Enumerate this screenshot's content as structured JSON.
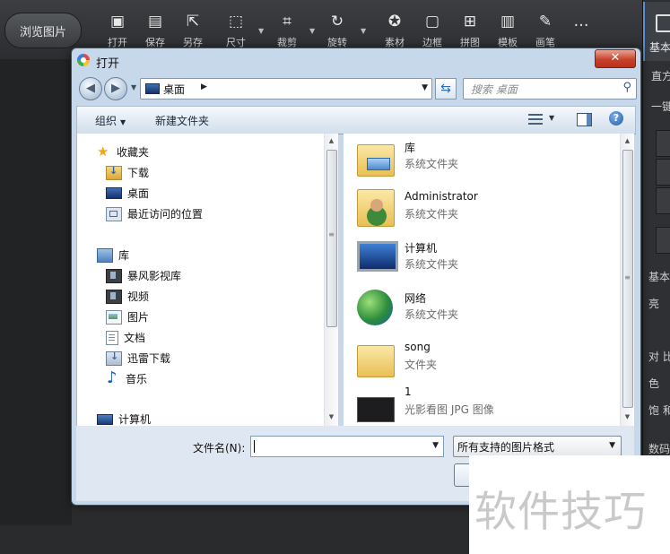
{
  "app": {
    "browse_button": "浏览图片",
    "tools": [
      {
        "label": "打开",
        "icon": "open-icon"
      },
      {
        "label": "保存",
        "icon": "save-icon"
      },
      {
        "label": "另存",
        "icon": "save-as-icon"
      },
      {
        "label": "尺寸",
        "icon": "resize-icon"
      },
      {
        "label": "裁剪",
        "icon": "crop-icon"
      },
      {
        "label": "旋转",
        "icon": "rotate-icon"
      },
      {
        "label": "素材",
        "icon": "sticker-icon"
      },
      {
        "label": "边框",
        "icon": "frame-icon"
      },
      {
        "label": "拼图",
        "icon": "collage-icon"
      },
      {
        "label": "模板",
        "icon": "template-icon"
      },
      {
        "label": "画笔",
        "icon": "brush-icon"
      },
      {
        "label": "…",
        "icon": "more-icon"
      }
    ],
    "right_panel": {
      "tab_label": "基本调",
      "row1": "直方",
      "row2": "一键",
      "row3": "基本",
      "adj_labels": [
        "亮",
        "对 比",
        "色",
        "饱 和"
      ],
      "row4": "数码"
    }
  },
  "dialog": {
    "title": "打开",
    "close_label": "✕",
    "breadcrumb": "桌面",
    "search_placeholder": "搜索 桌面",
    "toolbar": {
      "organize": "组织",
      "new_folder": "新建文件夹"
    },
    "nav": {
      "favorites": "收藏夹",
      "downloads": "下载",
      "desktop": "桌面",
      "recent": "最近访问的位置",
      "libraries": "库",
      "storm": "暴风影视库",
      "videos": "视频",
      "pictures": "图片",
      "documents": "文档",
      "xunlei": "迅雷下载",
      "music": "音乐",
      "computer": "计算机"
    },
    "files": [
      {
        "name": "库",
        "type": "系统文件夹",
        "icon": "library-folder-icon"
      },
      {
        "name": "Administrator",
        "type": "系统文件夹",
        "icon": "user-folder-icon"
      },
      {
        "name": "计算机",
        "type": "系统文件夹",
        "icon": "computer-icon"
      },
      {
        "name": "网络",
        "type": "系统文件夹",
        "icon": "network-icon"
      },
      {
        "name": "song",
        "type": "文件夹",
        "icon": "folder-icon"
      },
      {
        "name": "1",
        "type": "光影看图 JPG 图像",
        "icon": "image-thumbnail-icon"
      }
    ],
    "filename_label": "文件名(N):",
    "filename_value": "",
    "filter_value": "所有支持的图片格式"
  },
  "watermark": "软件技巧"
}
